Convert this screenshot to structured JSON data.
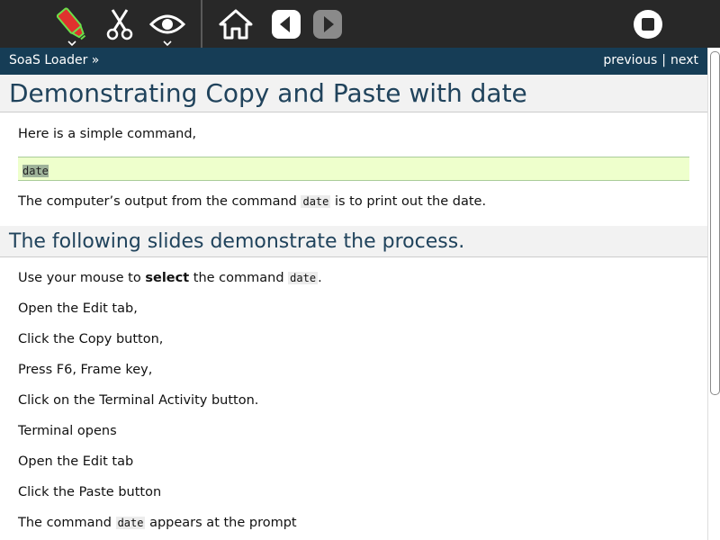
{
  "toolbar": {
    "icons": [
      "marker-icon",
      "scissors-icon",
      "eye-icon",
      "home-icon",
      "back-icon",
      "forward-icon",
      "stop-icon"
    ],
    "accent_color": "#6be04a"
  },
  "nav": {
    "breadcrumb": "SoaS Loader »",
    "previous": "previous",
    "separator": "|",
    "next": "next"
  },
  "page": {
    "title": "Demonstrating Copy and Paste with date",
    "intro": "Here is a simple command,",
    "code_block": "date",
    "output_before": "The computer’s output from the command ",
    "output_code": "date",
    "output_after": " is to print out the date.",
    "section_heading": "The following slides demonstrate the process.",
    "step1_before": "Use your mouse to ",
    "step1_bold": "select",
    "step1_middle": " the command ",
    "step1_code": "date",
    "step1_after": ".",
    "steps": [
      "Open the Edit tab,",
      "Click the Copy button,",
      "Press F6, Frame key,",
      "Click on the Terminal Activity button.",
      "Terminal opens",
      "Open the Edit tab",
      "Click the Paste button"
    ],
    "last_before": "The command ",
    "last_code": "date",
    "last_after": " appears at the prompt"
  }
}
